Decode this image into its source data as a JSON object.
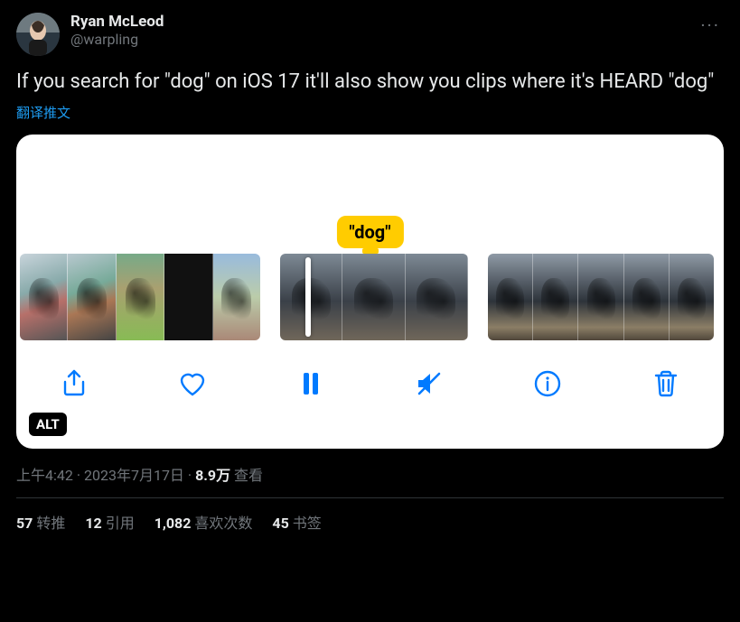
{
  "author": {
    "display_name": "Ryan McLeod",
    "handle": "@warpling"
  },
  "more_glyph": "···",
  "body_text": "If you search for \"dog\" on iOS 17 it'll also show you clips where it's HEARD \"dog\"",
  "translate_label": "翻译推文",
  "media": {
    "badge_text": "\"dog\"",
    "alt_badge": "ALT"
  },
  "meta": {
    "time": "上午4:42",
    "sep1": " · ",
    "date": "2023年7月17日",
    "sep2": " · ",
    "views_count": "8.9万",
    "views_label": " 查看"
  },
  "stats": {
    "retweets_count": "57",
    "retweets_label": "转推",
    "quotes_count": "12",
    "quotes_label": "引用",
    "likes_count": "1,082",
    "likes_label": "喜欢次数",
    "bookmarks_count": "45",
    "bookmarks_label": "书签"
  }
}
